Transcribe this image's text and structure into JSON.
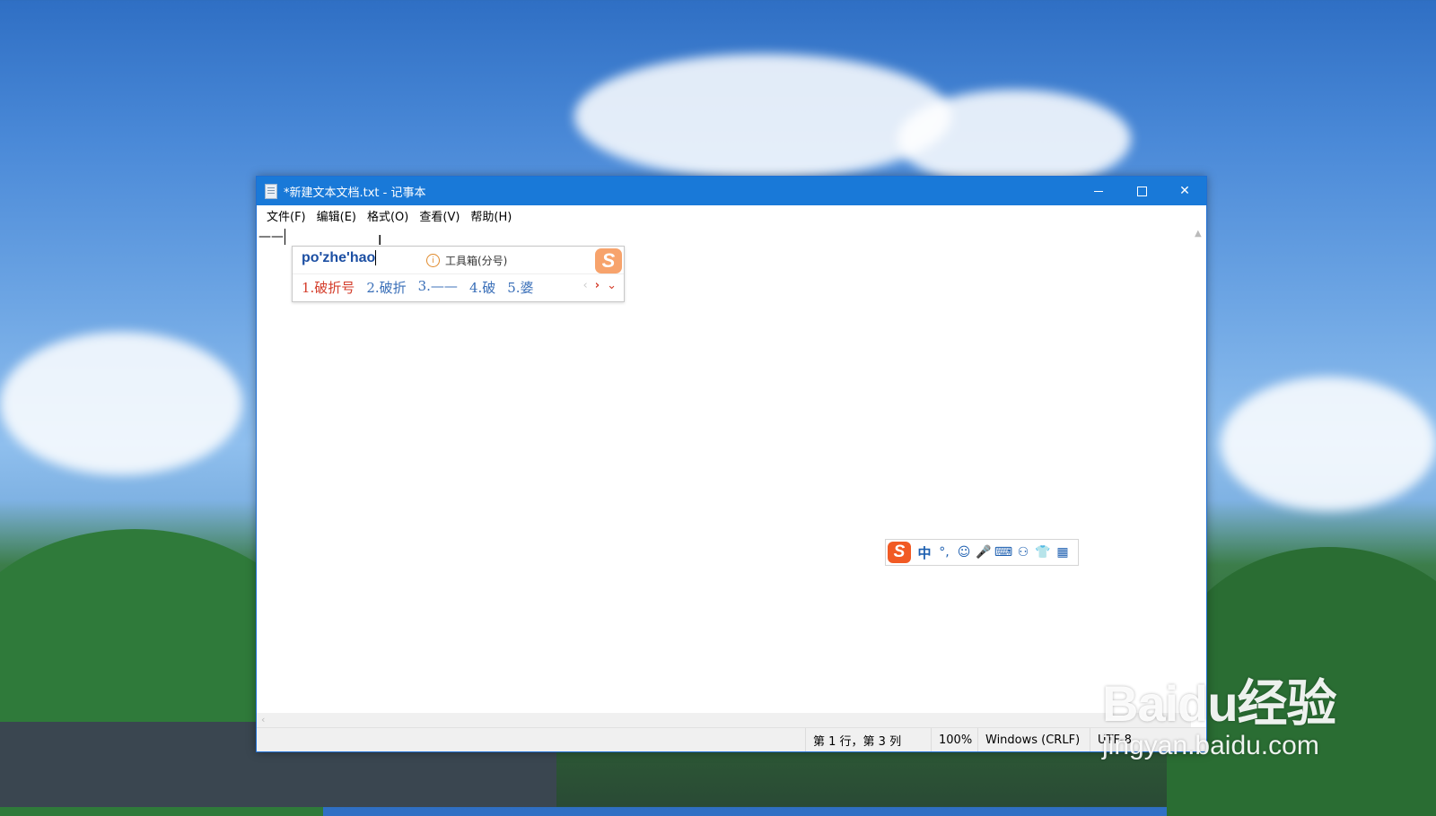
{
  "window": {
    "title": "*新建文本文档.txt - 记事本",
    "minimize": "",
    "close": "✕"
  },
  "menu": [
    "文件(F)",
    "编辑(E)",
    "格式(O)",
    "查看(V)",
    "帮助(H)"
  ],
  "editor": {
    "content": "——"
  },
  "statusbar": {
    "position": "第 1 行，第 3 列",
    "zoom": "100%",
    "line_ending": "Windows (CRLF)",
    "encoding": "UTF-8"
  },
  "ime": {
    "input": "po'zhe'hao",
    "tip": "工具箱(分号)",
    "logo": "S",
    "candidates": [
      "1.破折号",
      "2.破折",
      "3.——",
      "4.破",
      "5.婆"
    ],
    "nav_prev": "‹",
    "nav_next": "›",
    "nav_more": "⌄"
  },
  "ime_toolbar": {
    "logo": "S",
    "items": [
      {
        "name": "lang-toggle",
        "label": "中"
      },
      {
        "name": "punctuation-toggle",
        "label": "°,"
      },
      {
        "name": "emoji-icon",
        "label": "☺"
      },
      {
        "name": "microphone-icon",
        "label": "🎤"
      },
      {
        "name": "keyboard-icon",
        "label": "⌨"
      },
      {
        "name": "user-icon",
        "label": "⚇"
      },
      {
        "name": "skin-icon",
        "label": "👕"
      },
      {
        "name": "apps-icon",
        "label": "▦"
      }
    ]
  },
  "watermark": {
    "main": "Baidu经验",
    "sub": "jingyan.baidu.com"
  }
}
